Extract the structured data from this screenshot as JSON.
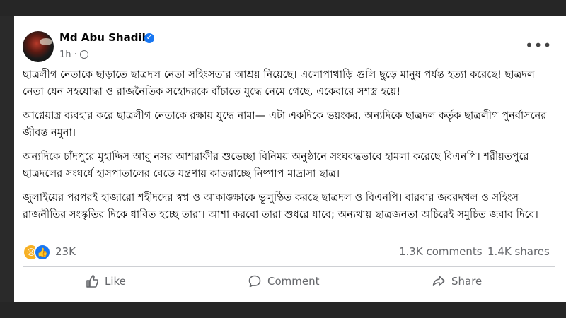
{
  "post": {
    "author": "Md Abu Shadik",
    "time": "1h ·",
    "more_label": "•••",
    "paragraphs": [
      "ছাত্রলীগ নেতাকে ছাড়াতে ছাত্রদল নেতা সহিংসতার আশ্রয় নিয়েছে। এলোপাথাড়ি গুলি ছুড়ে মানুষ পর্যন্ত হত্যা করেছে! ছাত্রদল নেতা যেন সহযোদ্ধা ও রাজনৈতিক সহোদরকে বাঁচাতে যুদ্ধে নেমে গেছে, একেবারে সশস্ত্র হয়ে!",
      "আগ্নেয়াস্ত্র ব্যবহার করে ছাত্রলীগ নেতাকে রক্ষায় যুদ্ধে নামা— এটা একদিকে ভয়ংকর, অন্যদিকে ছাত্রদল কর্তৃক ছাত্রলীগ পুনর্বাসনের জীবন্ত নমুনা।",
      "অন্যদিকে চাঁদপুরে মুহাদ্দিস আবু নসর আশরাফীর শুভেচ্ছা বিনিময় অনুষ্ঠানে সংঘবদ্ধভাবে হামলা করেছে বিএনপি। শরীয়তপুরে ছাত্রদলের সংঘর্ষে হাসপাতালের বেডে যন্ত্রণায় কাতরাচ্ছে নিষ্পাপ মাদ্রাসা ছাত্র।",
      "জুলাইয়ের পরপরই হাজারো শহীদদের স্বপ্ন ও আকাঙ্ক্ষাকে ভূলুণ্ঠিত করছে ছাত্রদল ও বিএনপি। বারবার জবরদখল ও সহিংস রাজনীতির সংস্কৃতির দিকে ধাবিত হচ্ছে তারা। আশা করবো তারা শুধরে যাবে; অন্যথায় ছাত্রজনতা অচিরেই সমুচিত জবাব দিবে।"
    ],
    "reaction_count": "23K",
    "comments": "1.3K comments",
    "shares": "1.4K shares"
  },
  "actions": {
    "like": "Like",
    "comment": "Comment",
    "share": "Share"
  },
  "icons": [
    "verified-badge-icon",
    "globe-icon",
    "more-options-icon",
    "sad-reaction-icon",
    "like-reaction-icon",
    "like-icon",
    "comment-icon",
    "share-icon"
  ],
  "colors": {
    "accent": "#1877f2",
    "muted": "#65676b",
    "sad": "#f7b125"
  }
}
